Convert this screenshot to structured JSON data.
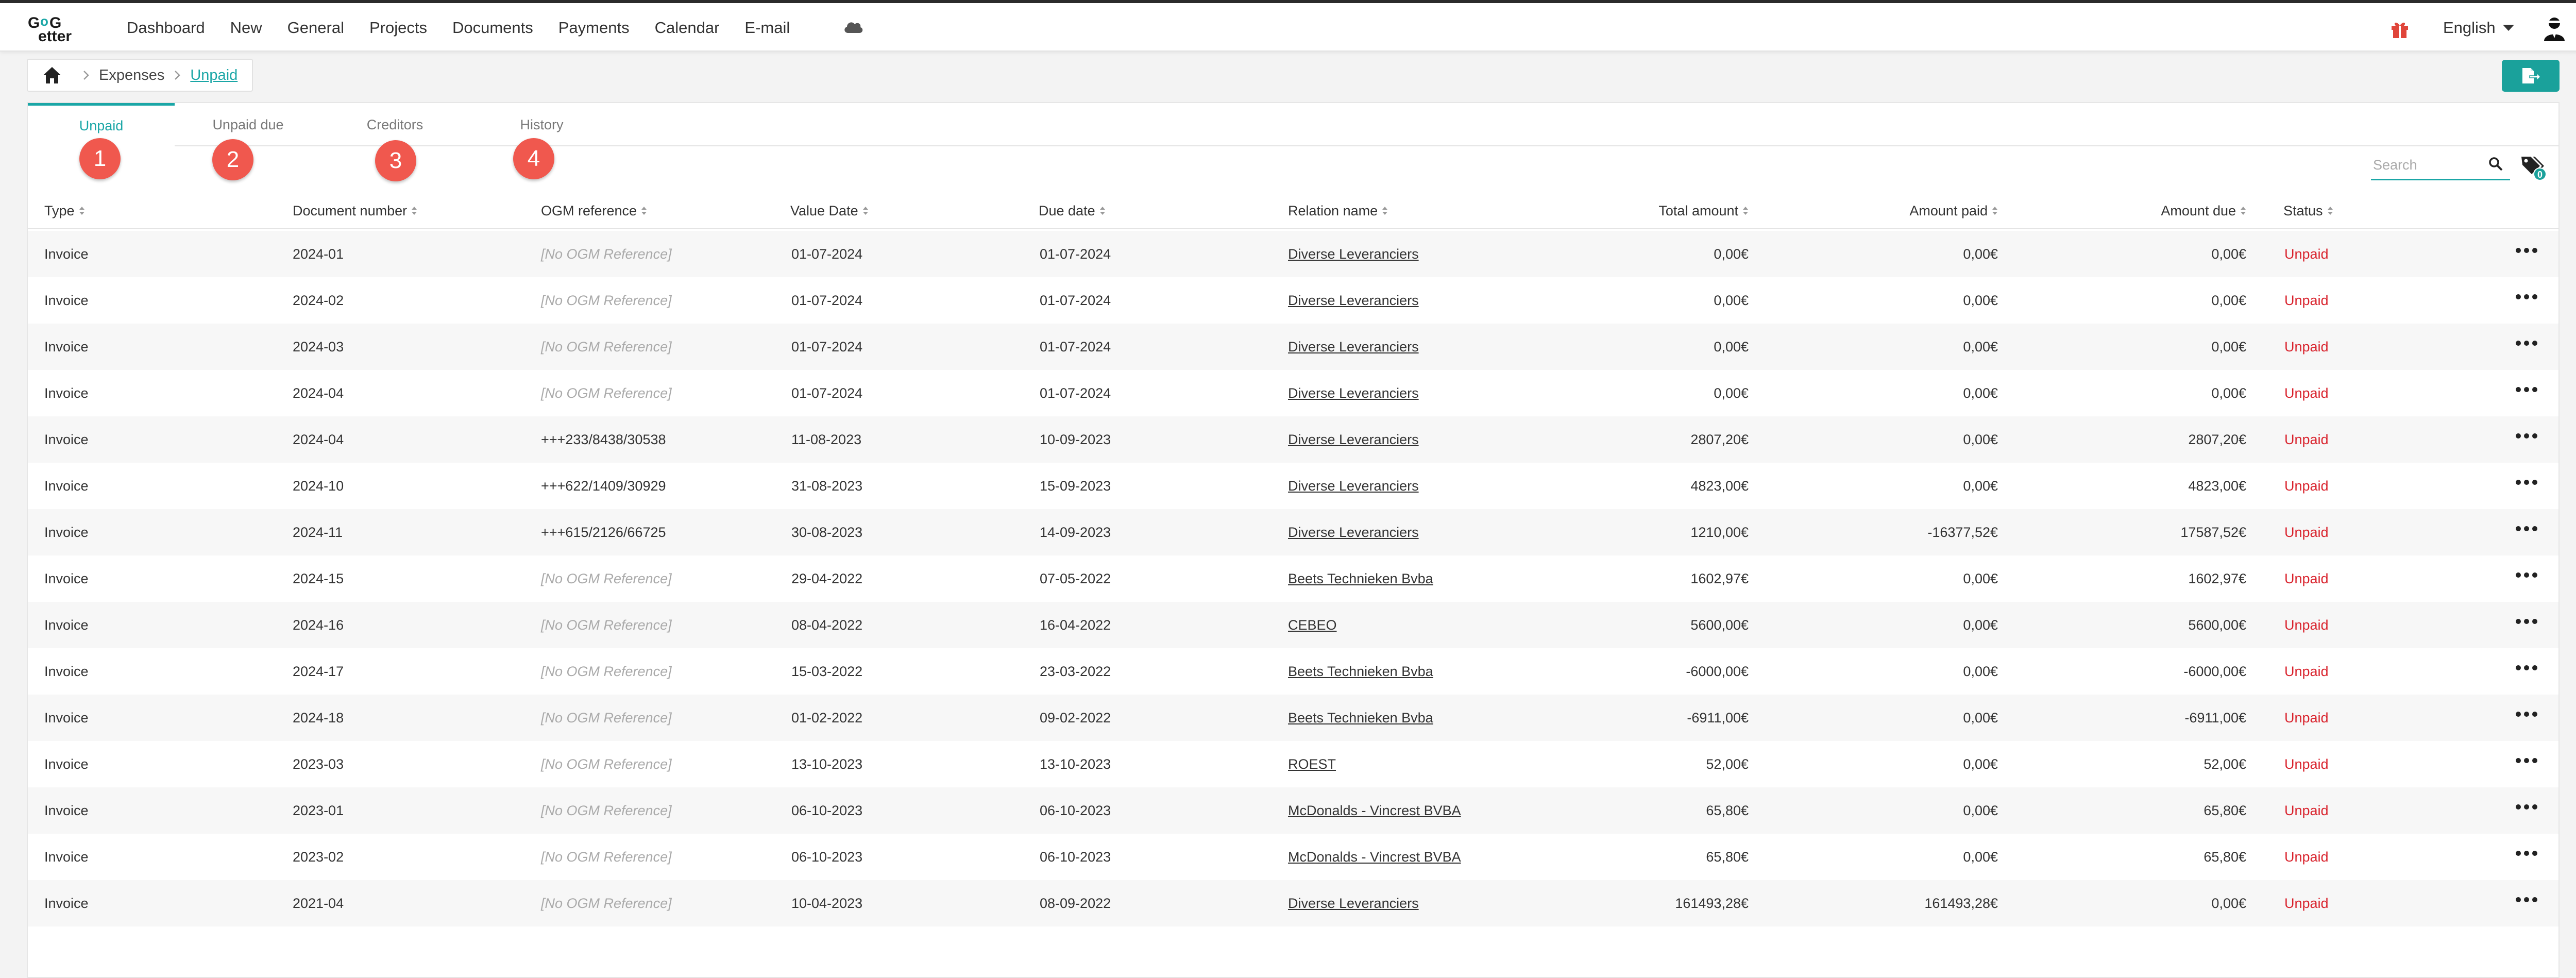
{
  "nav": {
    "logo_text": "GoGetter",
    "items": [
      "Dashboard",
      "New",
      "General",
      "Projects",
      "Documents",
      "Payments",
      "Calendar",
      "E-mail"
    ],
    "language": "English"
  },
  "breadcrumb": {
    "parent": "Expenses",
    "current": "Unpaid"
  },
  "tabs": [
    {
      "label": "Unpaid",
      "badge": "1"
    },
    {
      "label": "Unpaid due",
      "badge": "2"
    },
    {
      "label": "Creditors",
      "badge": "3"
    },
    {
      "label": "History",
      "badge": "4"
    }
  ],
  "search": {
    "placeholder": "Search",
    "value": ""
  },
  "filter_count": "0",
  "columns": [
    "Type",
    "Document number",
    "OGM reference",
    "Value Date",
    "Due date",
    "Relation name",
    "Total amount",
    "Amount paid",
    "Amount due",
    "Status"
  ],
  "rows": [
    {
      "type": "Invoice",
      "doc": "2024-01",
      "ogm": "[No OGM Reference]",
      "value_date": "01-07-2024",
      "due_date": "01-07-2024",
      "relation": "Diverse Leveranciers",
      "total": "0,00€",
      "paid": "0,00€",
      "due": "0,00€",
      "status": "Unpaid"
    },
    {
      "type": "Invoice",
      "doc": "2024-02",
      "ogm": "[No OGM Reference]",
      "value_date": "01-07-2024",
      "due_date": "01-07-2024",
      "relation": "Diverse Leveranciers",
      "total": "0,00€",
      "paid": "0,00€",
      "due": "0,00€",
      "status": "Unpaid"
    },
    {
      "type": "Invoice",
      "doc": "2024-03",
      "ogm": "[No OGM Reference]",
      "value_date": "01-07-2024",
      "due_date": "01-07-2024",
      "relation": "Diverse Leveranciers",
      "total": "0,00€",
      "paid": "0,00€",
      "due": "0,00€",
      "status": "Unpaid"
    },
    {
      "type": "Invoice",
      "doc": "2024-04",
      "ogm": "[No OGM Reference]",
      "value_date": "01-07-2024",
      "due_date": "01-07-2024",
      "relation": "Diverse Leveranciers",
      "total": "0,00€",
      "paid": "0,00€",
      "due": "0,00€",
      "status": "Unpaid"
    },
    {
      "type": "Invoice",
      "doc": "2024-04",
      "ogm": "+++233/8438/30538",
      "value_date": "11-08-2023",
      "due_date": "10-09-2023",
      "relation": "Diverse Leveranciers",
      "total": "2807,20€",
      "paid": "0,00€",
      "due": "2807,20€",
      "status": "Unpaid"
    },
    {
      "type": "Invoice",
      "doc": "2024-10",
      "ogm": "+++622/1409/30929",
      "value_date": "31-08-2023",
      "due_date": "15-09-2023",
      "relation": "Diverse Leveranciers",
      "total": "4823,00€",
      "paid": "0,00€",
      "due": "4823,00€",
      "status": "Unpaid"
    },
    {
      "type": "Invoice",
      "doc": "2024-11",
      "ogm": "+++615/2126/66725",
      "value_date": "30-08-2023",
      "due_date": "14-09-2023",
      "relation": "Diverse Leveranciers",
      "total": "1210,00€",
      "paid": "-16377,52€",
      "due": "17587,52€",
      "status": "Unpaid"
    },
    {
      "type": "Invoice",
      "doc": "2024-15",
      "ogm": "[No OGM Reference]",
      "value_date": "29-04-2022",
      "due_date": "07-05-2022",
      "relation": "Beets Technieken Bvba",
      "total": "1602,97€",
      "paid": "0,00€",
      "due": "1602,97€",
      "status": "Unpaid"
    },
    {
      "type": "Invoice",
      "doc": "2024-16",
      "ogm": "[No OGM Reference]",
      "value_date": "08-04-2022",
      "due_date": "16-04-2022",
      "relation": "CEBEO",
      "total": "5600,00€",
      "paid": "0,00€",
      "due": "5600,00€",
      "status": "Unpaid"
    },
    {
      "type": "Invoice",
      "doc": "2024-17",
      "ogm": "[No OGM Reference]",
      "value_date": "15-03-2022",
      "due_date": "23-03-2022",
      "relation": "Beets Technieken Bvba",
      "total": "-6000,00€",
      "paid": "0,00€",
      "due": "-6000,00€",
      "status": "Unpaid"
    },
    {
      "type": "Invoice",
      "doc": "2024-18",
      "ogm": "[No OGM Reference]",
      "value_date": "01-02-2022",
      "due_date": "09-02-2022",
      "relation": "Beets Technieken Bvba",
      "total": "-6911,00€",
      "paid": "0,00€",
      "due": "-6911,00€",
      "status": "Unpaid"
    },
    {
      "type": "Invoice",
      "doc": "2023-03",
      "ogm": "[No OGM Reference]",
      "value_date": "13-10-2023",
      "due_date": "13-10-2023",
      "relation": "ROEST",
      "total": "52,00€",
      "paid": "0,00€",
      "due": "52,00€",
      "status": "Unpaid"
    },
    {
      "type": "Invoice",
      "doc": "2023-01",
      "ogm": "[No OGM Reference]",
      "value_date": "06-10-2023",
      "due_date": "06-10-2023",
      "relation": "McDonalds - Vincrest BVBA",
      "total": "65,80€",
      "paid": "0,00€",
      "due": "65,80€",
      "status": "Unpaid"
    },
    {
      "type": "Invoice",
      "doc": "2023-02",
      "ogm": "[No OGM Reference]",
      "value_date": "06-10-2023",
      "due_date": "06-10-2023",
      "relation": "McDonalds - Vincrest BVBA",
      "total": "65,80€",
      "paid": "0,00€",
      "due": "65,80€",
      "status": "Unpaid"
    },
    {
      "type": "Invoice",
      "doc": "2021-04",
      "ogm": "[No OGM Reference]",
      "value_date": "10-04-2023",
      "due_date": "08-09-2022",
      "relation": "Diverse Leveranciers",
      "total": "161493,28€",
      "paid": "161493,28€",
      "due": "0,00€",
      "status": "Unpaid"
    }
  ],
  "colors": {
    "accent": "#1aa6a6",
    "status_unpaid": "#d9232d",
    "badge": "#f0584e",
    "gift": "#e0453a"
  }
}
